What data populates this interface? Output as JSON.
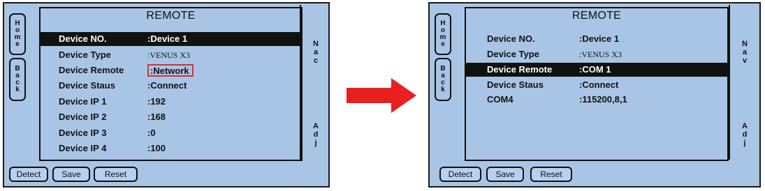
{
  "before": {
    "title": "REMOTE",
    "side_buttons": {
      "home": [
        "H",
        "o",
        "m",
        "e"
      ],
      "back": [
        "B",
        "a",
        "c",
        "k"
      ]
    },
    "rows": [
      {
        "label": "Device NO.",
        "value": ":Device 1",
        "selected": true,
        "highlighted": false
      },
      {
        "label": "Device Type",
        "value": ":VENUS X3",
        "selected": false,
        "highlighted": false
      },
      {
        "label": "Device Remote",
        "value": ":Network",
        "selected": false,
        "highlighted": true
      },
      {
        "label": "Device Staus",
        "value": ":Connect",
        "selected": false,
        "highlighted": false
      },
      {
        "label": "Device IP 1",
        "value": ":192",
        "selected": false,
        "highlighted": false
      },
      {
        "label": "Device IP 2",
        "value": ":168",
        "selected": false,
        "highlighted": false
      },
      {
        "label": "Device IP 3",
        "value": ":0",
        "selected": false,
        "highlighted": false
      },
      {
        "label": "Device IP 4",
        "value": ":100",
        "selected": false,
        "highlighted": false
      }
    ],
    "nav": [
      "N",
      "a",
      "c"
    ],
    "adj": [
      "A",
      "d",
      "j"
    ],
    "buttons": {
      "detect": "Detect",
      "save": "Save",
      "reset": "Reset"
    }
  },
  "after": {
    "title": "REMOTE",
    "side_buttons": {
      "home": [
        "H",
        "o",
        "m",
        "e"
      ],
      "back": [
        "B",
        "a",
        "c",
        "k"
      ]
    },
    "rows": [
      {
        "label": "Device NO.",
        "value": ":Device 1",
        "selected": false,
        "highlighted": false
      },
      {
        "label": "Device Type",
        "value": ":VENUS X3",
        "selected": false,
        "highlighted": false
      },
      {
        "label": "Device Remote",
        "value": ":COM 1",
        "selected": true,
        "highlighted": false
      },
      {
        "label": "Device Staus",
        "value": ":Connect",
        "selected": false,
        "highlighted": false
      },
      {
        "label": "COM4",
        "value": ":115200,8,1",
        "selected": false,
        "highlighted": false
      }
    ],
    "nav": [
      "N",
      "a",
      "v"
    ],
    "adj": [
      "A",
      "d",
      "j"
    ],
    "buttons": {
      "detect": "Detect",
      "save": "Save",
      "reset": "Reset"
    }
  },
  "colors": {
    "panel": "#a9c5e6",
    "selection": "#111111",
    "highlight_box": "#d62f2f",
    "arrow": "#e8211e"
  },
  "icons": {
    "transition": "arrow-right-icon"
  }
}
